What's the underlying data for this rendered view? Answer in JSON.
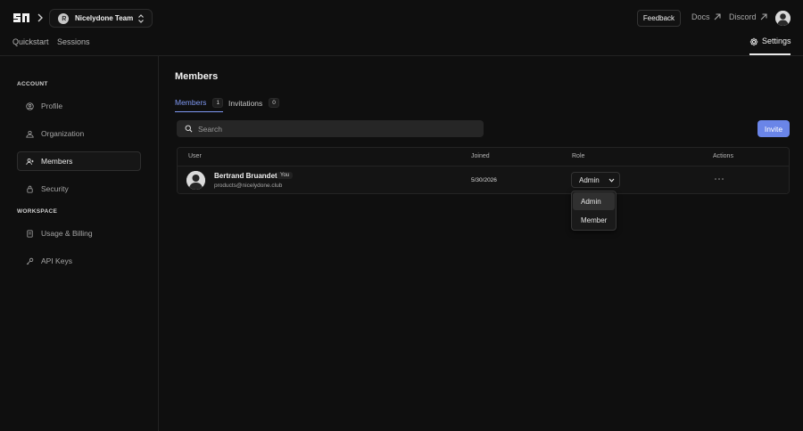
{
  "header": {
    "team_name": "Nicelydone Team",
    "feedback_label": "Feedback",
    "docs_label": "Docs",
    "discord_label": "Discord"
  },
  "nav": {
    "quickstart": "Quickstart",
    "sessions": "Sessions",
    "settings": "Settings"
  },
  "sidebar": {
    "account_label": "ACCOUNT",
    "workspace_label": "WORKSPACE",
    "items": [
      {
        "label": "Profile",
        "icon": "user-circle-icon"
      },
      {
        "label": "Organization",
        "icon": "organization-icon"
      },
      {
        "label": "Members",
        "icon": "users-icon",
        "active": true
      },
      {
        "label": "Security",
        "icon": "lock-icon"
      },
      {
        "label": "Usage & Billing",
        "icon": "receipt-icon"
      },
      {
        "label": "API Keys",
        "icon": "key-icon"
      }
    ]
  },
  "main": {
    "title": "Members",
    "tabs": [
      {
        "label": "Members",
        "count": "1",
        "active": true
      },
      {
        "label": "Invitations",
        "count": "0",
        "active": false
      }
    ],
    "search_placeholder": "Search",
    "invite_label": "Invite",
    "table": {
      "columns": [
        "User",
        "Joined",
        "Role",
        "Actions"
      ],
      "rows": [
        {
          "name": "Bertrand Bruandet",
          "badge": "You",
          "email": "products@nicelydone.club",
          "joined": "5/30/2026",
          "role": "Admin"
        }
      ]
    },
    "role_options": [
      "Admin",
      "Member"
    ],
    "role_selected": "Admin"
  },
  "colors": {
    "background": "#0f0f0f",
    "accent": "#6a85e8",
    "active_tab": "#7f98f2"
  }
}
